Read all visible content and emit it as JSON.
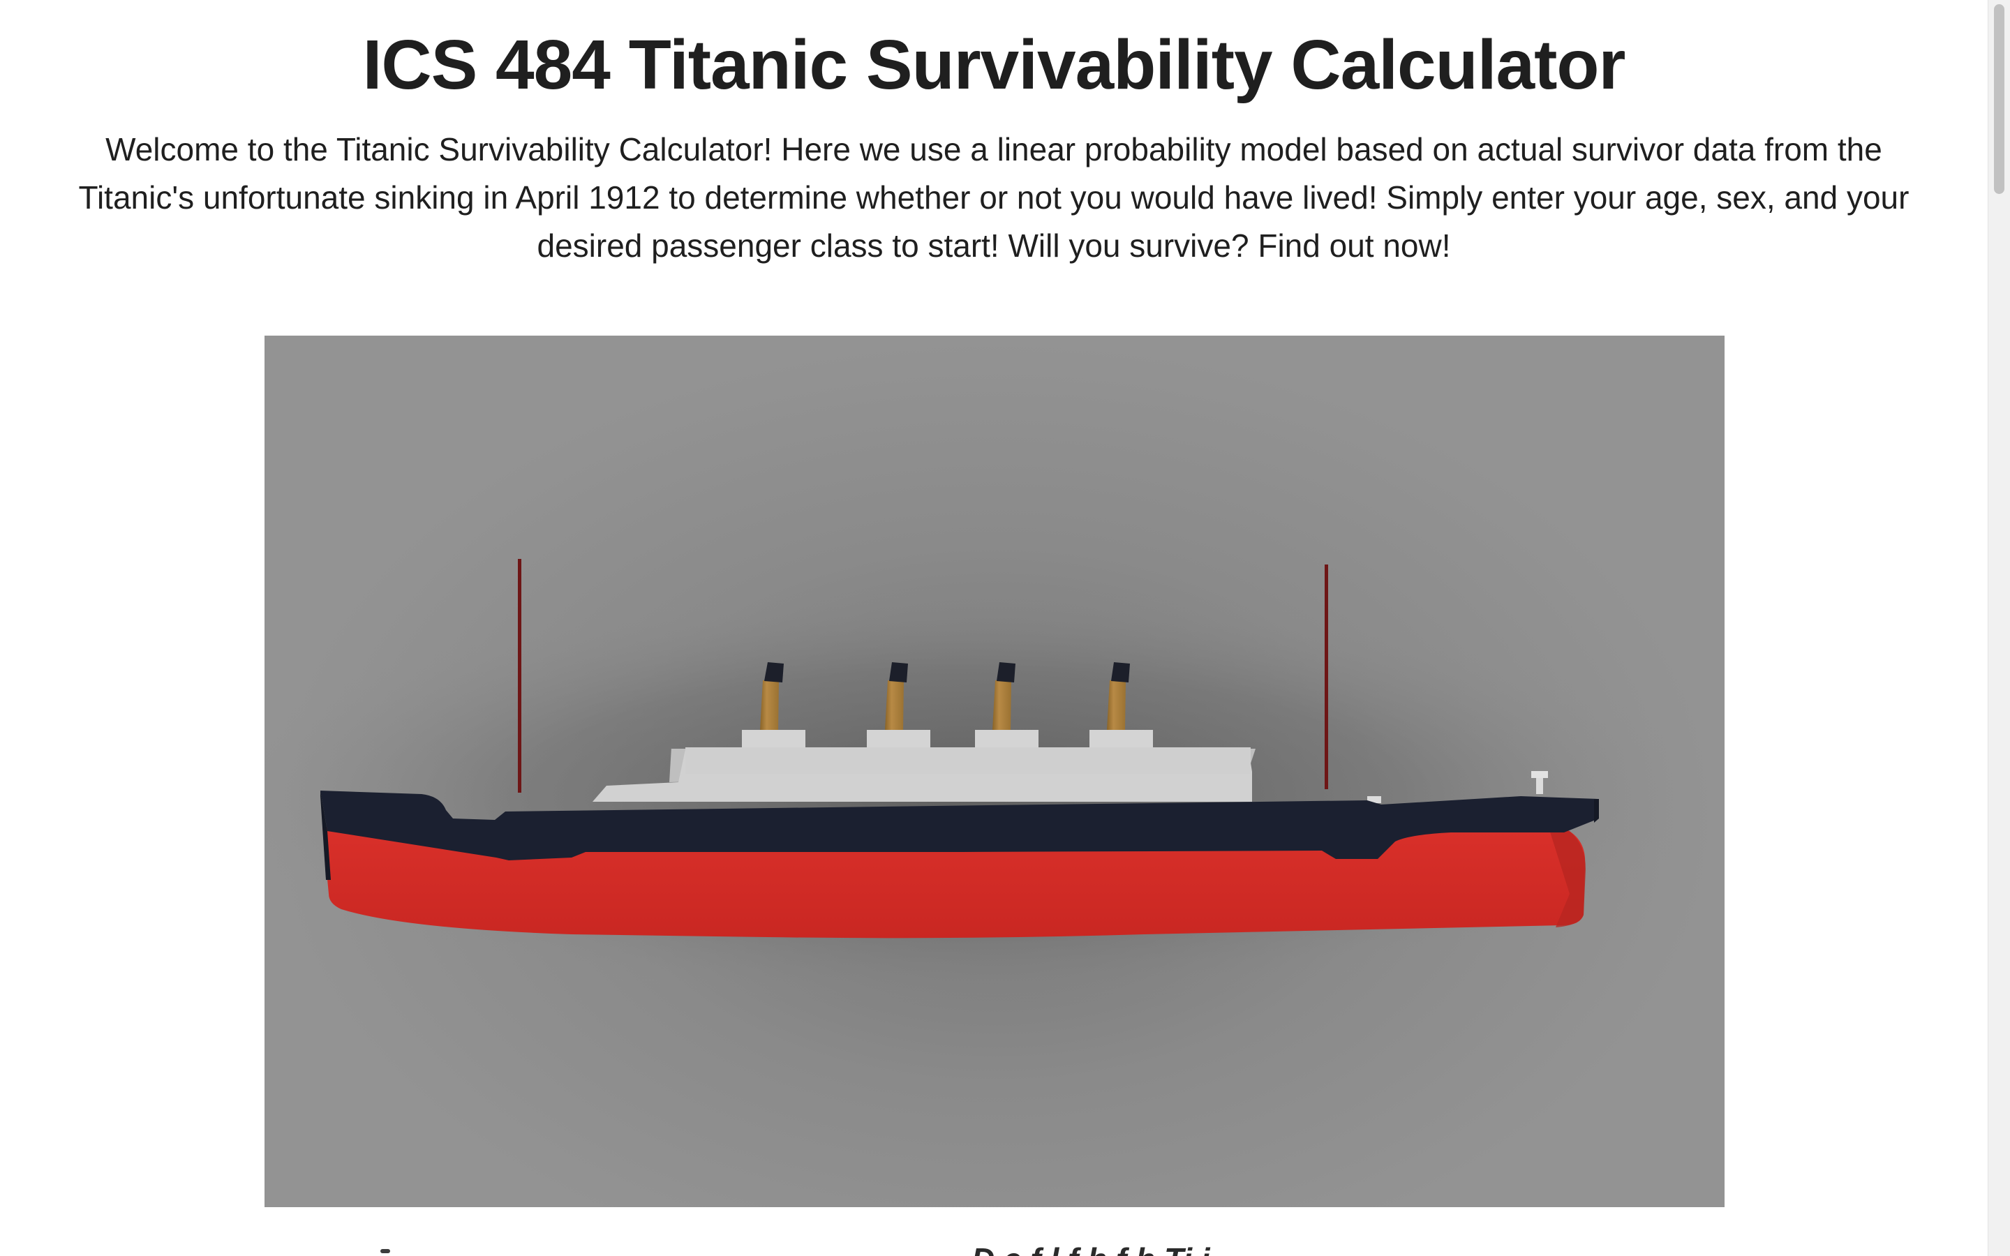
{
  "page": {
    "title": "ICS 484 Titanic Survivability Calculator",
    "intro": "Welcome to the Titanic Survivability Calculator! Here we use a linear probability model based on actual survivor data from the Titanic's unfortunate sinking in April 1912 to determine whether or not you would have lived! Simply enter your age, sex, and your desired passenger class to start! Will you survive? Find out now!"
  },
  "hero": {
    "subject": "3D model of the Titanic ship (side view)",
    "colors": {
      "background": "#8f8f8f",
      "hull_red": "#d22a26",
      "hull_dark": "#1a1f2c",
      "superstructure": "#cfcfcf",
      "funnel": "#b0823f",
      "funnel_top": "#1c1f2a",
      "mast": "#7a1a1a"
    }
  },
  "below_fold": {
    "partial_text": "D  e  f        l     f          h         f    h   Ti     i"
  }
}
